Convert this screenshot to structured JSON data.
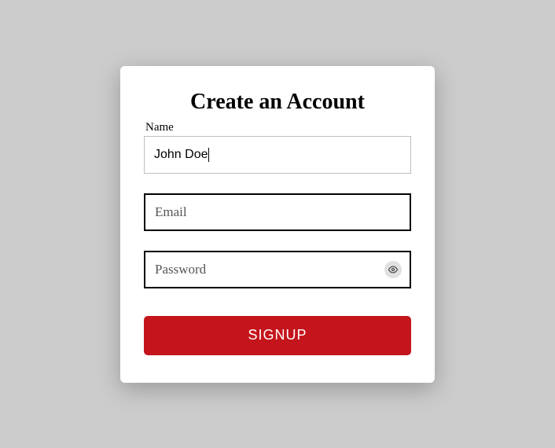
{
  "title": "Create an Account",
  "name": {
    "label": "Name",
    "value": "John Doe"
  },
  "email": {
    "placeholder": "Email"
  },
  "password": {
    "placeholder": "Password"
  },
  "signup_button": "SIGNUP"
}
